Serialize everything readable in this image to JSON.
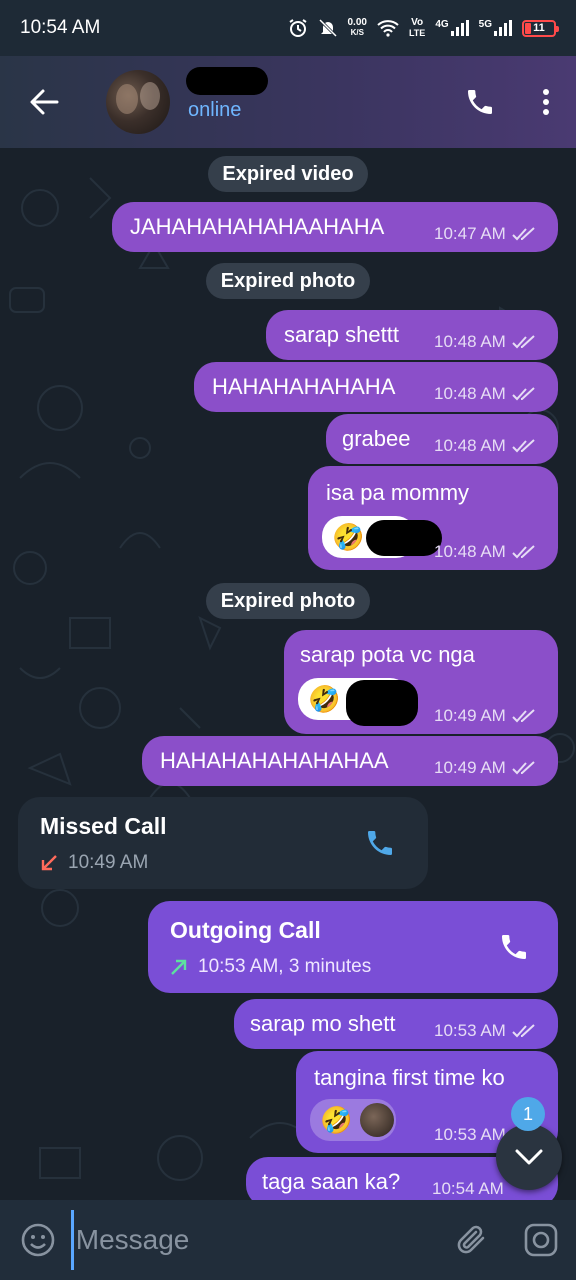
{
  "status": {
    "time": "10:54 AM",
    "net_speed_top": "0.00",
    "net_speed_bottom": "K/S",
    "volte_top": "Vo",
    "volte_bottom": "LTE",
    "net4g": "4G",
    "net5g": "5G",
    "battery": "11",
    "battery_color": "#ff4a4a"
  },
  "header": {
    "status_text": "online",
    "accent": "#6fb6ff"
  },
  "messages": {
    "svc_expired_video": "Expired video",
    "m1_text": "JAHAHAHAHAHAAHAHA",
    "m1_time": "10:47 AM",
    "svc_expired_photo_1": "Expired photo",
    "m2_text": "sarap shettt",
    "m2_time": "10:48 AM",
    "m3_text": "HAHAHAHAHAHA",
    "m3_time": "10:48 AM",
    "m4_text": "grabee",
    "m4_time": "10:48 AM",
    "m5_text": "isa pa mommy",
    "m5_time": "10:48 AM",
    "m5_emoji": "🤣",
    "svc_expired_photo_2": "Expired photo",
    "m6_text": "sarap pota vc nga",
    "m6_time": "10:49 AM",
    "m6_emoji": "🤣",
    "m7_text": "HAHAHAHAHAHAHAA",
    "m7_time": "10:49 AM",
    "missed_title": "Missed Call",
    "missed_time": "10:49 AM",
    "outgoing_title": "Outgoing Call",
    "outgoing_time": "10:53 AM, 3 minutes",
    "m8_text": "sarap mo shett",
    "m8_time": "10:53 AM",
    "m9_text": "tangina first time ko",
    "m9_time": "10:53 AM",
    "m9_emoji": "🤣",
    "m10_text": "taga saan ka?",
    "m10_time": "10:54 AM"
  },
  "scroll": {
    "unread_count": "1"
  },
  "input": {
    "placeholder": "Message"
  },
  "colors": {
    "outgoing_bubble": "#8b4fc9",
    "outgoing_bubble_recent": "#7a4ed6",
    "incoming_bubble": "#222c37",
    "missed_arrow": "#ff6b5b",
    "outgoing_arrow": "#5de0a0",
    "call_icon_incoming": "#4fa8e8"
  }
}
